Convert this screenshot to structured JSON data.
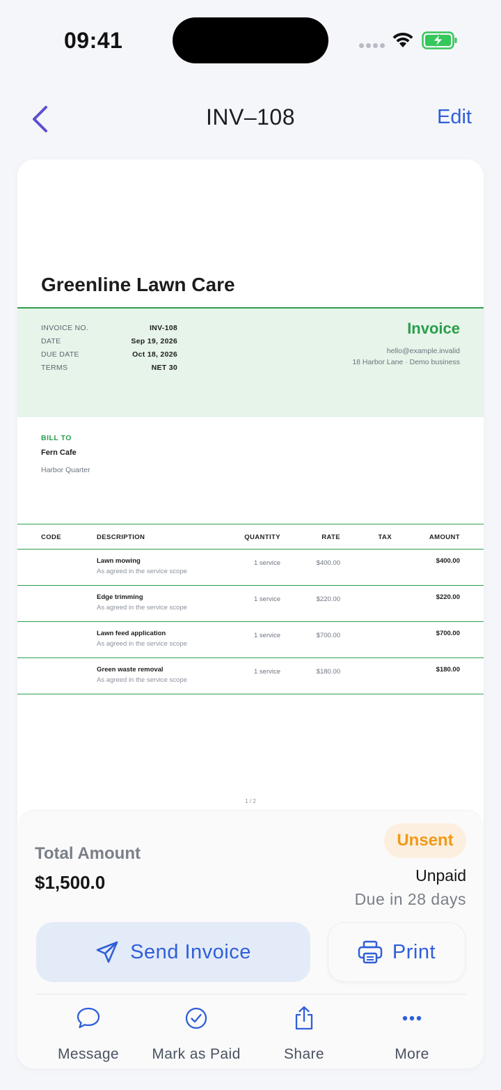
{
  "status_bar": {
    "time": "09:41"
  },
  "nav": {
    "title": "INV–108",
    "edit_label": "Edit"
  },
  "invoice": {
    "company": "Greenline Lawn Care",
    "heading": "Invoice",
    "business_email": "hello@example.invalid",
    "business_address": "18 Harbor Lane · Demo business",
    "meta": [
      {
        "label": "INVOICE NO.",
        "value": "INV-108"
      },
      {
        "label": "DATE",
        "value": "Sep 19, 2026"
      },
      {
        "label": "DUE DATE",
        "value": "Oct 18, 2026"
      },
      {
        "label": "TERMS",
        "value": "NET 30"
      }
    ],
    "bill_to_label": "BILL TO",
    "client_name": "Fern Cafe",
    "client_area": "Harbor Quarter",
    "columns": [
      "CODE",
      "DESCRIPTION",
      "QUANTITY",
      "RATE",
      "TAX",
      "AMOUNT"
    ],
    "items": [
      {
        "description": "Lawn mowing",
        "note": "As agreed in the service scope",
        "quantity": "1 service",
        "rate": "$400.00",
        "amount": "$400.00"
      },
      {
        "description": "Edge trimming",
        "note": "As agreed in the service scope",
        "quantity": "1 service",
        "rate": "$220.00",
        "amount": "$220.00"
      },
      {
        "description": "Lawn feed application",
        "note": "As agreed in the service scope",
        "quantity": "1 service",
        "rate": "$700.00",
        "amount": "$700.00"
      },
      {
        "description": "Green waste removal",
        "note": "As agreed in the service scope",
        "quantity": "1 service",
        "rate": "$180.00",
        "amount": "$180.00"
      }
    ],
    "page_indicator": "1 / 2"
  },
  "summary": {
    "total_label": "Total Amount",
    "total_value": "$1,500.0",
    "badge": "Unsent",
    "payment_status": "Unpaid",
    "due_text": "Due in 28 days",
    "send_label": "Send Invoice",
    "print_label": "Print"
  },
  "actions": [
    {
      "label": "Message",
      "icon": "chat-bubble-icon"
    },
    {
      "label": "Mark as Paid",
      "icon": "check-circle-icon"
    },
    {
      "label": "Share",
      "icon": "share-icon"
    },
    {
      "label": "More",
      "icon": "more-dots-icon"
    }
  ],
  "colors": {
    "accent": "#2f5fd8",
    "brand_green": "#2a9d4c",
    "badge_orange": "#ee9a1a"
  }
}
